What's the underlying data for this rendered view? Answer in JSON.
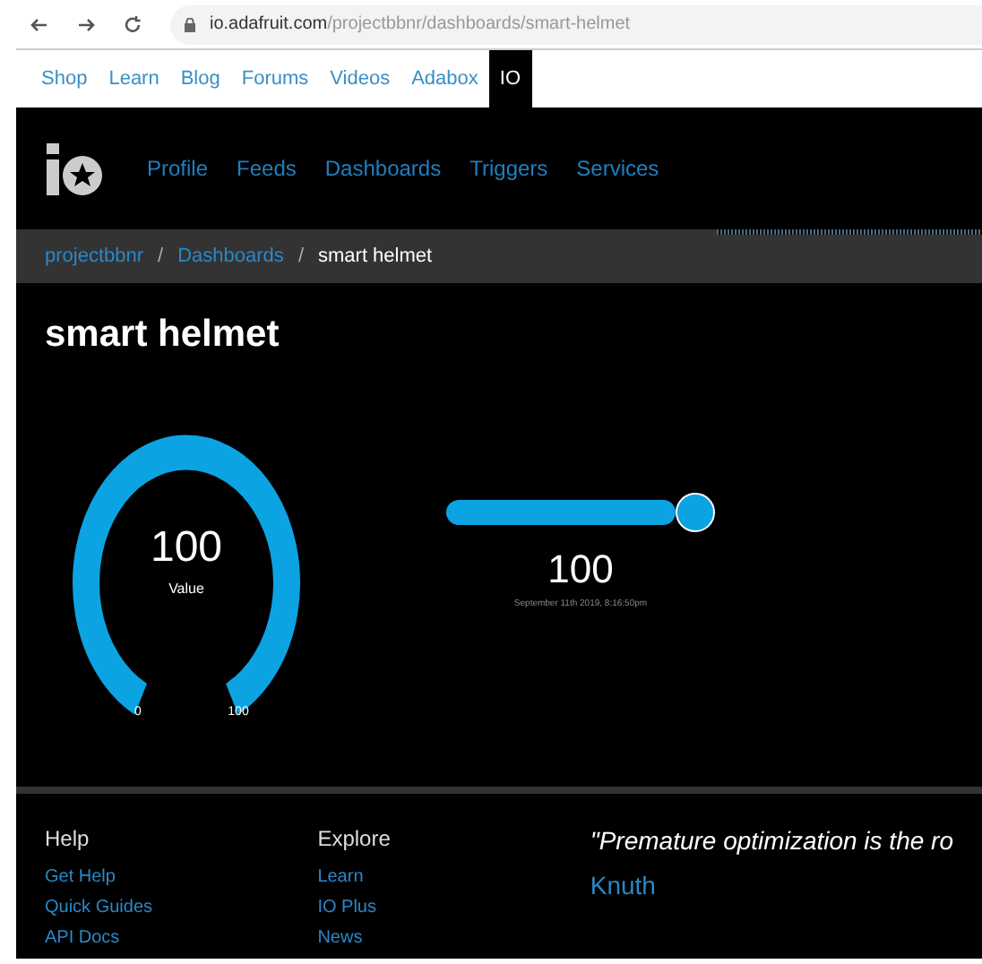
{
  "browser": {
    "url_host": "io.adafruit.com",
    "url_path": "/projectbbnr/dashboards/smart-helmet"
  },
  "top_nav": [
    {
      "label": "Shop",
      "selected": false
    },
    {
      "label": "Learn",
      "selected": false
    },
    {
      "label": "Blog",
      "selected": false
    },
    {
      "label": "Forums",
      "selected": false
    },
    {
      "label": "Videos",
      "selected": false
    },
    {
      "label": "Adabox",
      "selected": false
    },
    {
      "label": "IO",
      "selected": true
    }
  ],
  "header_nav": [
    "Profile",
    "Feeds",
    "Dashboards",
    "Triggers",
    "Services"
  ],
  "breadcrumb": [
    {
      "kind": "link",
      "text": "projectbbnr"
    },
    {
      "kind": "separator",
      "text": "/"
    },
    {
      "kind": "link",
      "text": "Dashboards"
    },
    {
      "kind": "separator",
      "text": "/"
    },
    {
      "kind": "current",
      "text": "smart helmet"
    }
  ],
  "title": "smart helmet",
  "gauge": {
    "value": "100",
    "label": "Value",
    "min": "0",
    "max": "100"
  },
  "slider": {
    "value": "100",
    "timestamp": "September 11th 2019, 8:16:50pm"
  },
  "footer": {
    "columns": [
      {
        "heading": "Help",
        "links": [
          "Get Help",
          "Quick Guides",
          "API Docs"
        ]
      },
      {
        "heading": "Explore",
        "links": [
          "Learn",
          "IO Plus",
          "News"
        ]
      }
    ],
    "quote": "\"Premature optimization is the ro",
    "author": "Knuth"
  }
}
